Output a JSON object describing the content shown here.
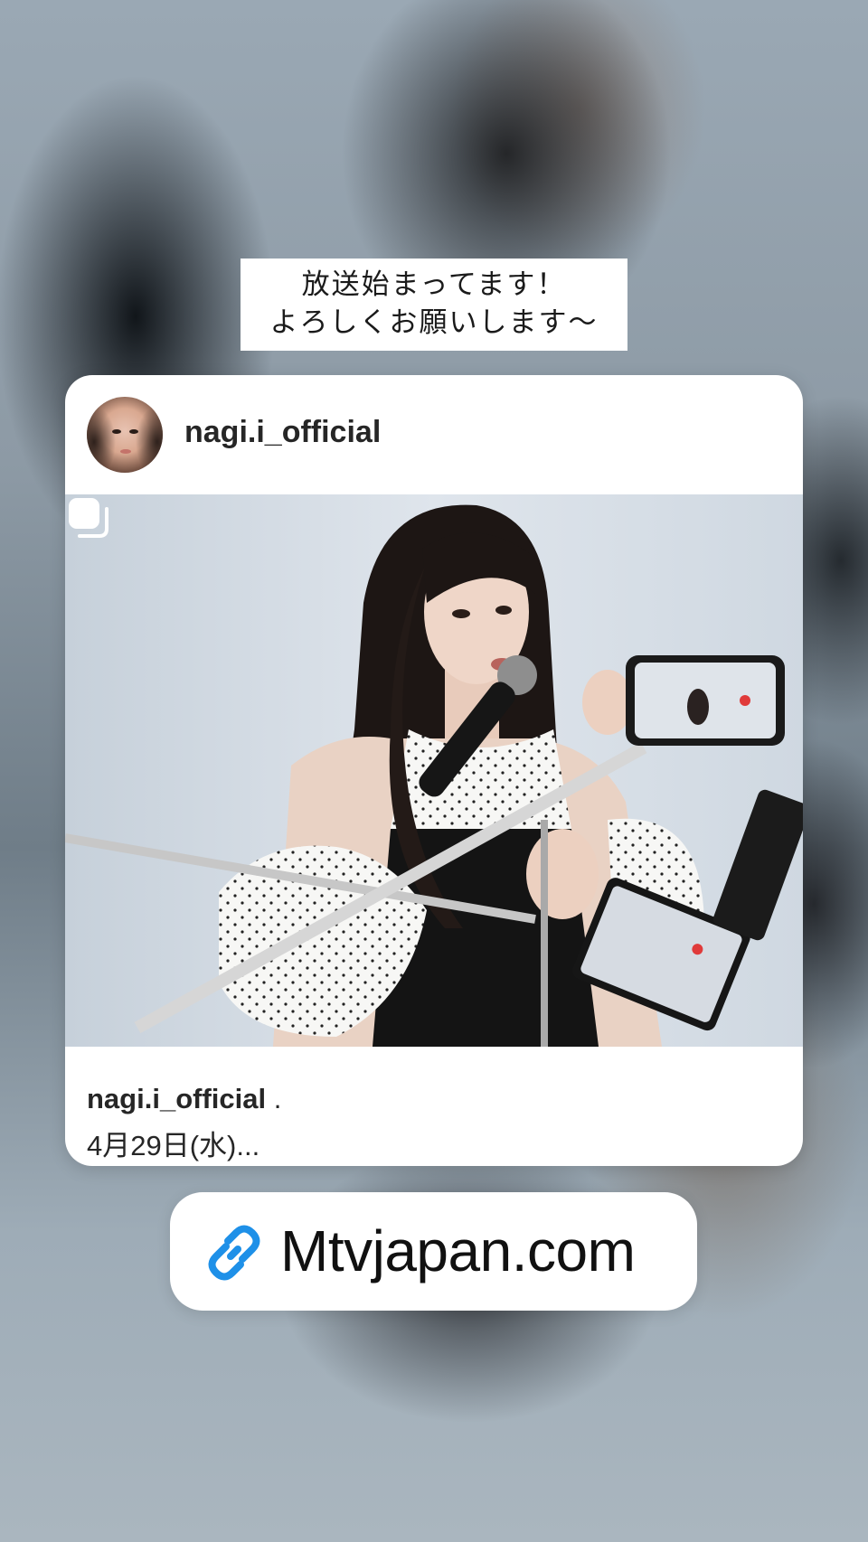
{
  "caption": {
    "line1": "放送始まってます！",
    "line2": "よろしくお願いします〜"
  },
  "post": {
    "username": "nagi.i_official",
    "footer_username": "nagi.i_official",
    "footer_separator": ".",
    "footer_date": "4月29日(水)...",
    "multi_photo_icon": "carousel-icon"
  },
  "link_sticker": {
    "icon": "link-icon",
    "label": "Mtvjapan.com",
    "icon_color": "#1e90e8"
  }
}
